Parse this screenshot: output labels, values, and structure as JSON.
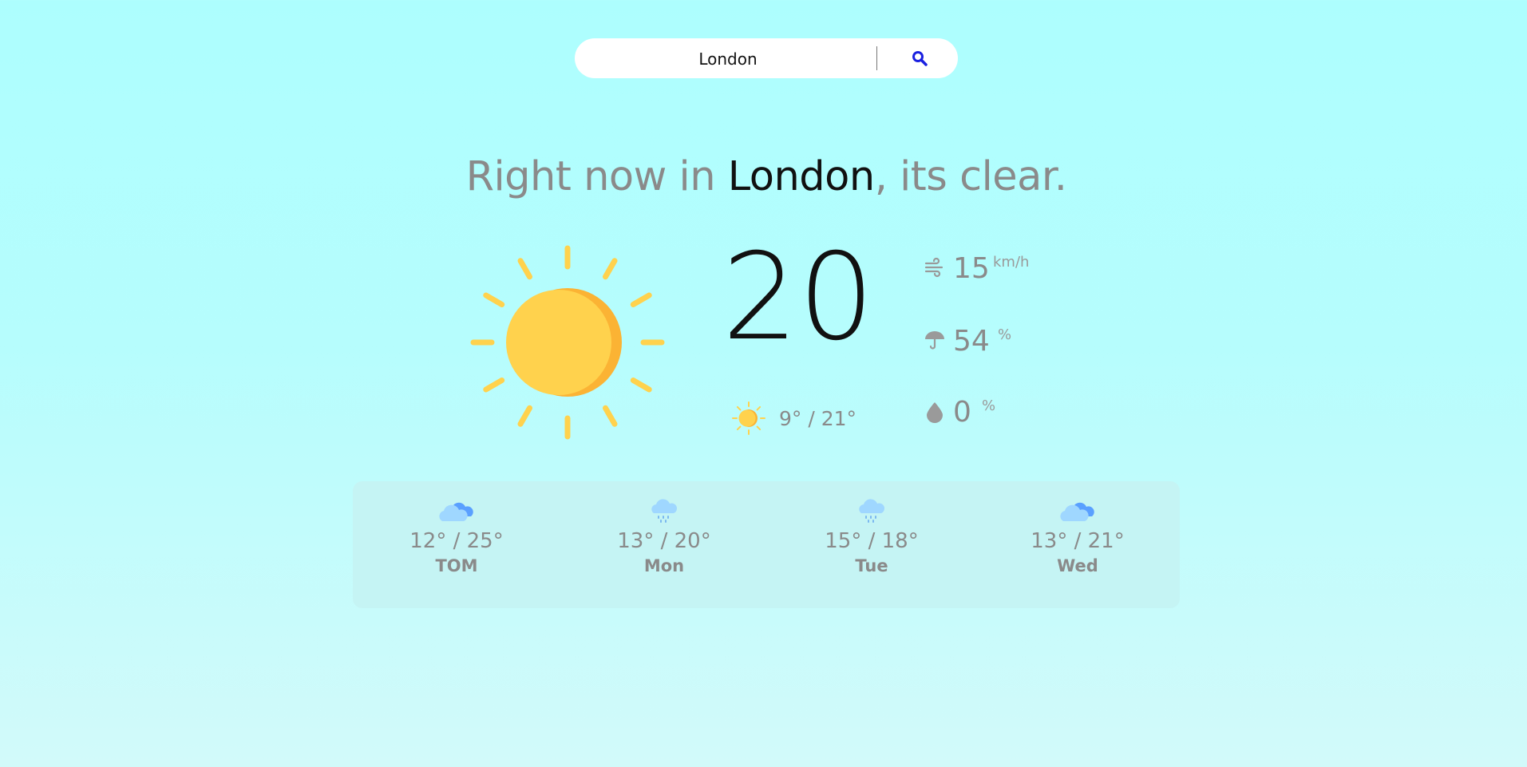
{
  "search": {
    "value": "London"
  },
  "headline": {
    "prefix": "Right now in ",
    "city": "London",
    "suffix": ", its clear."
  },
  "current": {
    "temperature": "20",
    "range": "9° / 21°",
    "wind": {
      "value": "15",
      "unit": "km/h"
    },
    "humidity": {
      "value": "54",
      "unit": "%"
    },
    "precipitation": {
      "value": "0",
      "unit": "%"
    }
  },
  "forecast": [
    {
      "temps": "12° / 25°",
      "day": "TOM",
      "icon": "cloudy-icon"
    },
    {
      "temps": "13° / 20°",
      "day": "Mon",
      "icon": "rain-icon"
    },
    {
      "temps": "15° / 18°",
      "day": "Tue",
      "icon": "rain-icon"
    },
    {
      "temps": "13° / 21°",
      "day": "Wed",
      "icon": "cloudy-icon"
    }
  ],
  "colors": {
    "sun": "#ffd24d",
    "sun_shadow": "#fbb334",
    "search_icon": "#1a20e0",
    "text_grey": "#8a8a8a"
  }
}
